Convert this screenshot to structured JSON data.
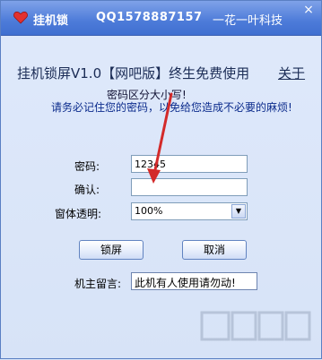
{
  "window": {
    "title": "挂机锁",
    "qq": "QQ1578887157",
    "company": "一花一叶科技",
    "close_glyph": "×"
  },
  "header": {
    "heading": "挂机锁屏V1.0【网吧版】终生免费使用",
    "about_link": "关于"
  },
  "notices": {
    "line1": "密码区分大小写!",
    "line2": "请务必记住您的密码，以免给您造成不必要的麻烦!"
  },
  "form": {
    "password_label": "密码:",
    "password_value": "12345",
    "confirm_label": "确认:",
    "confirm_value": "",
    "opacity_label": "窗体透明:",
    "opacity_value": "100%",
    "lock_button": "锁屏",
    "cancel_button": "取消",
    "message_label": "机主留言:",
    "message_value": "此机有人使用请勿动!"
  },
  "colors": {
    "titlebar": "#4d7bd9",
    "background": "#d7e3f7",
    "annotation_arrow": "#d32a2a"
  },
  "icons": {
    "app": "heart-icon",
    "dropdown": "chevron-down-icon"
  }
}
